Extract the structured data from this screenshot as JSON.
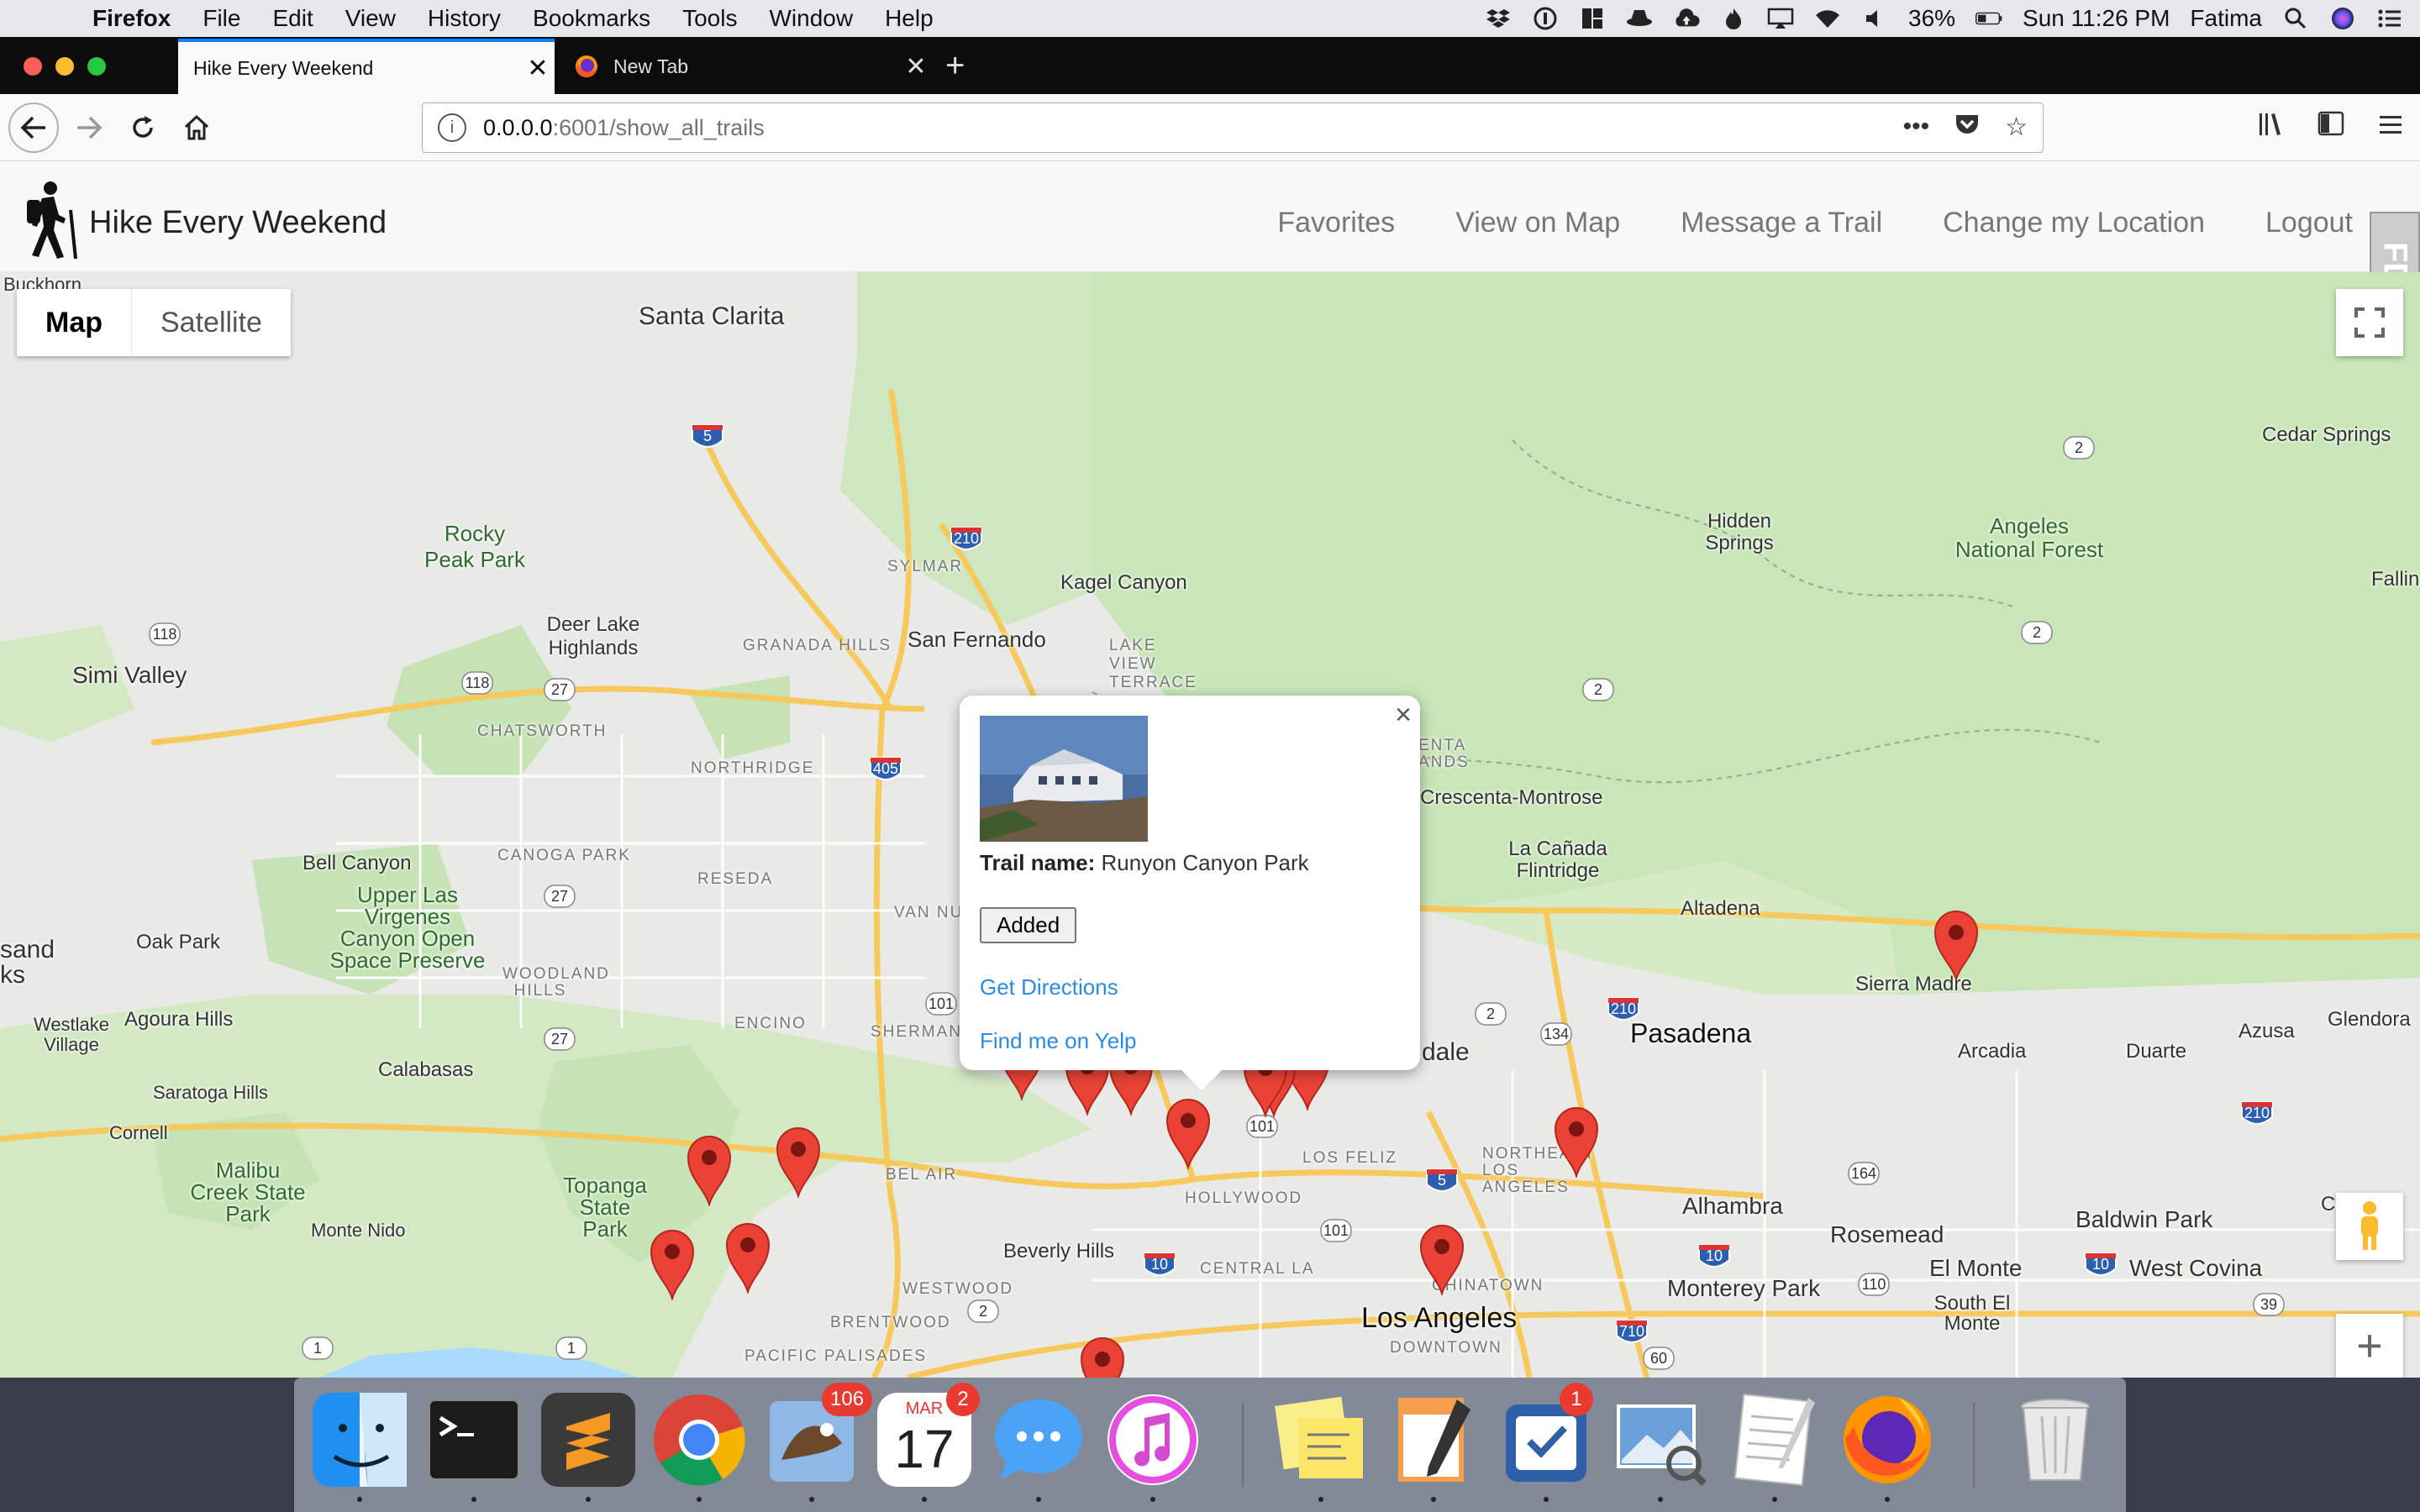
{
  "menubar": {
    "app_name": "Firefox",
    "items": [
      "File",
      "Edit",
      "View",
      "History",
      "Bookmarks",
      "Tools",
      "Window",
      "Help"
    ],
    "battery": "36%",
    "clock": "Sun 11:26 PM",
    "user": "Fatima"
  },
  "tabs": [
    {
      "title": "Hike Every Weekend",
      "active": true
    },
    {
      "title": "New Tab",
      "active": false
    }
  ],
  "urlbar": {
    "host": "0.0.0.0",
    "rest": ":6001/show_all_trails"
  },
  "site": {
    "title": "Hike Every Weekend",
    "nav": [
      "Favorites",
      "View on Map",
      "Message a Trail",
      "Change my Location",
      "Logout"
    ]
  },
  "map": {
    "type_controls": {
      "map": "Map",
      "satellite": "Satellite",
      "selected": "Map"
    },
    "labels": [
      "Santa Clarita",
      "Rocky Peak Park",
      "Simi Valley",
      "Deer Lake Highlands",
      "San Fernando",
      "Kagel Canyon",
      "SYLMAR",
      "GRANADA HILLS",
      "LAKE VIEW TERRACE",
      "CHATSWORTH",
      "NORTHRIDGE",
      "Bell Canyon",
      "Upper Las Virgenes Canyon Open Space Preserve",
      "CANOGA PARK",
      "RESEDA",
      "Oak Park",
      "WOODLAND HILLS",
      "Agoura Hills",
      "Westlake Village",
      "Calabasas",
      "Saratoga Hills",
      "Cornell",
      "Malibu Creek State Park",
      "Monte Nido",
      "Topanga State Park",
      "ENCINO",
      "SHERMAN",
      "VAN NU",
      "BEL AIR",
      "Beverly Hills",
      "WESTWOOD",
      "BRENTWOOD",
      "PACIFIC PALISADES",
      "HOLLYWOOD",
      "LOS FELIZ",
      "CENTRAL LA",
      "Los Angeles",
      "DOWNTOWN",
      "CHINATOWN",
      "NORTHEAST LOS ANGELES",
      "Alhambra",
      "Rosemead",
      "Monterey Park",
      "El Monte",
      "South El Monte",
      "West Covina",
      "Baldwin Park",
      "Covina",
      "Pasadena",
      "Altadena",
      "La Cañada Flintridge",
      "Crescenta-Montrose",
      "Sierra Madre",
      "Arcadia",
      "Duarte",
      "Azusa",
      "Glendora",
      "Hidden Springs",
      "Angeles National Forest",
      "Cedar Springs",
      "Fallin",
      "dale",
      "sand ks",
      "Buckhorn",
      "ENTA ANDS"
    ],
    "route_shields": [
      "5",
      "210",
      "118",
      "118",
      "27",
      "405",
      "101",
      "27",
      "27",
      "101",
      "134",
      "210",
      "2",
      "2",
      "2",
      "2",
      "210",
      "164",
      "10",
      "10",
      "10",
      "710",
      "5",
      "101",
      "110",
      "1",
      "1",
      "2",
      "39",
      "60"
    ]
  },
  "info_window": {
    "trail_name_label": "Trail name:",
    "trail_name": "Runyon Canyon Park",
    "added_button": "Added",
    "directions_link": "Get Directions",
    "yelp_link": "Find me on Yelp"
  },
  "dock": {
    "mail_badge": "106",
    "calendar_month": "MAR",
    "calendar_day": "17",
    "calendar_badge": "2",
    "reminders_badge": "1"
  },
  "colors": {
    "accent_tab": "#0a84ff",
    "link": "#2a8be6",
    "marker": "#ea4335",
    "park": "#c5e3b5",
    "highway": "#f7c95c"
  }
}
